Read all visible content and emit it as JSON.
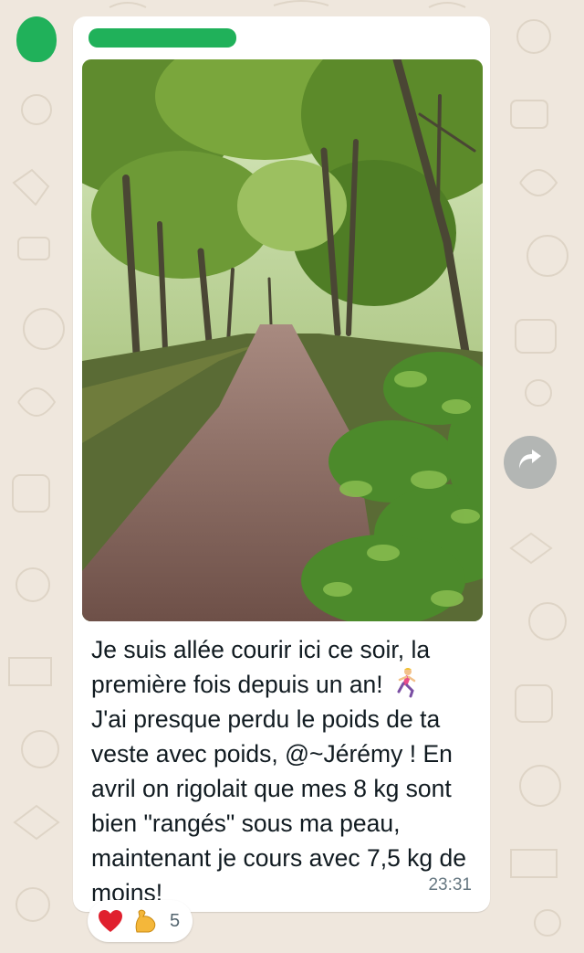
{
  "chat": {
    "sender_name": "",
    "message": {
      "caption_text": "Je suis allée courir ici ce soir, la première fois depuis un an! ",
      "caption_emoji": "woman-running-icon",
      "caption_text_2": "\nJ'ai presque perdu le poids de ta veste avec poids, @~Jérémy ! En avril on rigolait que mes 8 kg sont bien \"rangés\" sous ma peau, maintenant je cours avec 7,5 kg de moins!",
      "time": "23:31"
    },
    "reactions": {
      "icons": [
        "red-heart-icon",
        "flexed-biceps-icon"
      ],
      "count": "5"
    },
    "forward_button_icon": "forward-arrow-icon"
  },
  "colors": {
    "wallpaper": "#efe7dd",
    "avatar_redaction": "#20b15a",
    "name_redaction": "#20b15a",
    "bubble": "#ffffff",
    "timestamp": "#667781"
  }
}
